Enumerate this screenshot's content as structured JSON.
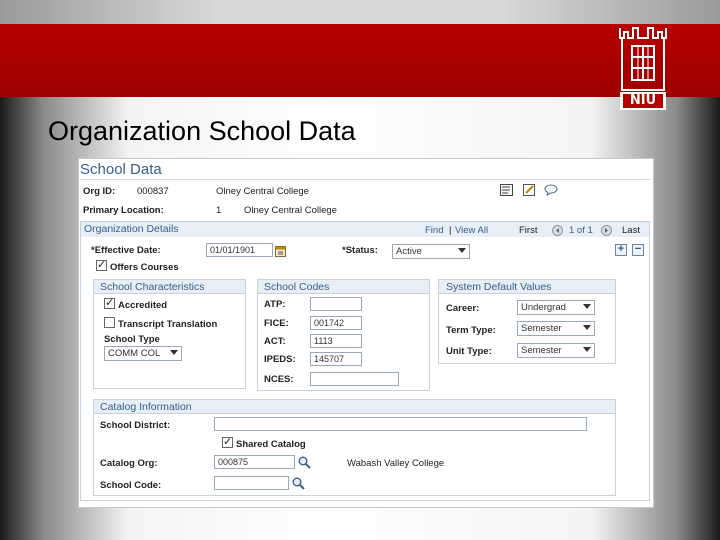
{
  "slide_title": "Organization School Data",
  "logo": {
    "text": "NIU",
    "icon": "niu-castle-logo"
  },
  "page": {
    "title": "School Data",
    "org_id_label": "Org ID:",
    "org_id_value": "000837",
    "org_name": "Olney Central College",
    "primary_location_label": "Primary Location:",
    "primary_location_num": "1",
    "primary_location_name": "Olney Central College",
    "header_icons": [
      "notepad-icon",
      "edit-icon",
      "chat-icon"
    ]
  },
  "org_details": {
    "title": "Organization Details",
    "nav": {
      "find": "Find",
      "sep": "|",
      "view_all": "View All",
      "first": "First",
      "page": "1 of 1",
      "last": "Last"
    },
    "effective_date_label": "*Effective Date:",
    "effective_date_value": "01/01/1901",
    "status_label": "*Status:",
    "status_value": "Active",
    "offers_courses_label": "Offers Courses"
  },
  "school_characteristics": {
    "title": "School Characteristics",
    "accredited_label": "Accredited",
    "transcript_label": "Transcript Translation",
    "school_type_label": "School Type",
    "school_type_value": "COMM COL"
  },
  "school_codes": {
    "title": "School Codes",
    "atp_label": "ATP:",
    "atp_value": "",
    "fice_label": "FICE:",
    "fice_value": "001742",
    "act_label": "ACT:",
    "act_value": "1113",
    "ipeds_label": "IPEDS:",
    "ipeds_value": "145707",
    "nces_label": "NCES:",
    "nces_value": ""
  },
  "system_defaults": {
    "title": "System Default Values",
    "career_label": "Career:",
    "career_value": "Undergrad",
    "term_type_label": "Term Type:",
    "term_type_value": "Semester",
    "unit_type_label": "Unit Type:",
    "unit_type_value": "Semester"
  },
  "catalog": {
    "title": "Catalog Information",
    "district_label": "School District:",
    "district_value": "",
    "shared_catalog_label": "Shared Catalog",
    "catalog_org_label": "Catalog Org:",
    "catalog_org_value": "000875",
    "catalog_org_name": "Wabash Valley College",
    "school_code_label": "School Code:",
    "school_code_value": ""
  }
}
